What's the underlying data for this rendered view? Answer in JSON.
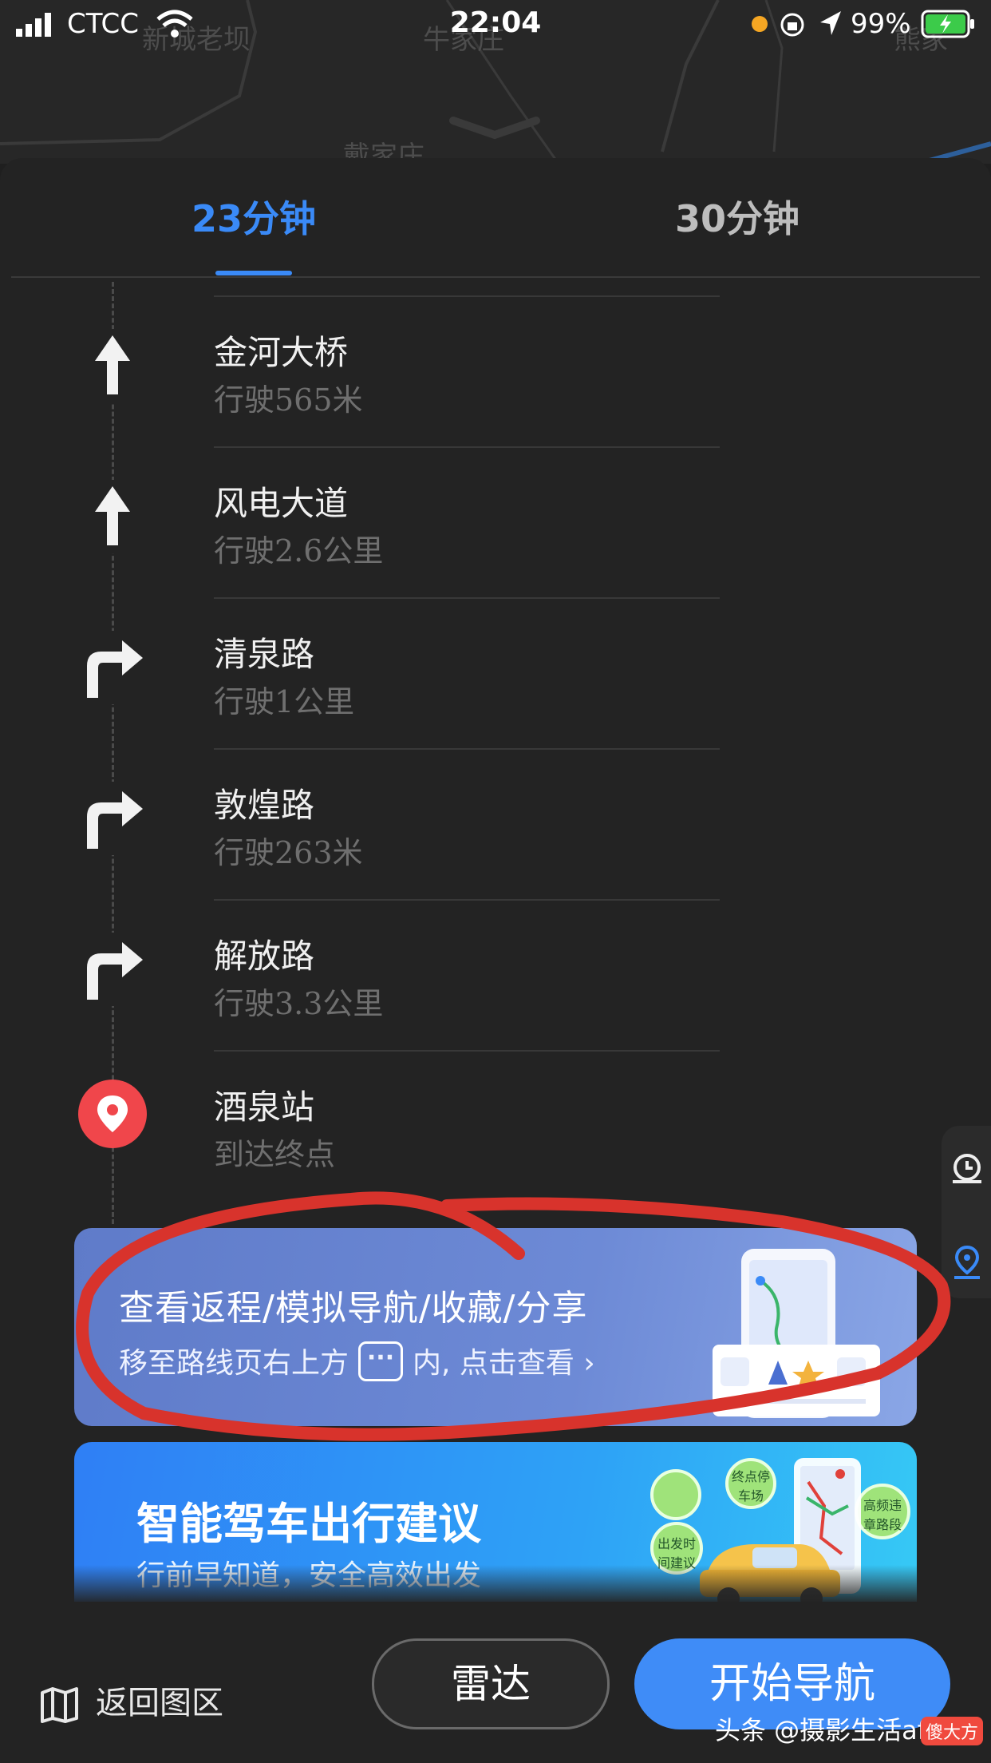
{
  "status_bar": {
    "carrier": "CTCC",
    "time": "22:04",
    "battery": "99%"
  },
  "map": {
    "labels": [
      "新城老坝",
      "牛家庄",
      "戴家庄",
      "熊家"
    ]
  },
  "tabs": [
    {
      "label": "23分钟",
      "active": true
    },
    {
      "label": "30分钟",
      "active": false
    }
  ],
  "steps": [
    {
      "road": "金河大桥",
      "dist": "行驶565米",
      "icon": "straight-arrow-icon"
    },
    {
      "road": "风电大道",
      "dist": "行驶2.6公里",
      "icon": "straight-arrow-icon"
    },
    {
      "road": "清泉路",
      "dist": "行驶1公里",
      "icon": "turn-right-icon"
    },
    {
      "road": "敦煌路",
      "dist": "行驶263米",
      "icon": "turn-right-icon"
    },
    {
      "road": "解放路",
      "dist": "行驶3.3公里",
      "icon": "turn-right-icon"
    },
    {
      "road": "酒泉站",
      "dist": "到达终点",
      "icon": "destination-pin-icon"
    }
  ],
  "banner_tips": {
    "title": "查看返程/模拟导航/收藏/分享",
    "sub_before": "移至路线页右上方",
    "more_glyph": "···",
    "sub_after": "内, 点击查看",
    "chevron": "›"
  },
  "banner_drive": {
    "title": "智能驾车出行建议",
    "sub": "行前早知道，安全高效出发",
    "bubbles": [
      "终点停车场",
      "出发时间建议",
      "高频违章路段"
    ]
  },
  "bottom_bar": {
    "back_map": "返回图区",
    "radar": "雷达",
    "start_nav": "开始导航"
  },
  "watermark": {
    "text": "头条 @摄影生活af",
    "logo": "傻大方"
  },
  "colors": {
    "accent": "#3a8af7",
    "annotation": "#d8332c",
    "pin": "#f0464b"
  }
}
